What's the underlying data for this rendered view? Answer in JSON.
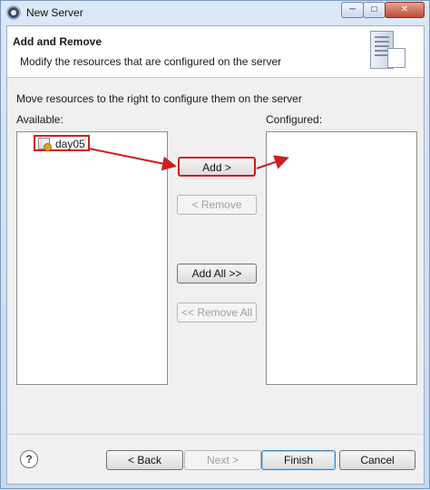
{
  "window": {
    "title": "New Server",
    "min_glyph": "─",
    "max_glyph": "□",
    "close_glyph": "✕"
  },
  "header": {
    "title": "Add and Remove",
    "description": "Modify the resources that are configured on the server"
  },
  "body": {
    "instructions": "Move resources to the right to configure them on the server",
    "available_label": "Available:",
    "configured_label": "Configured:",
    "available_items": [
      {
        "label": "day05"
      }
    ]
  },
  "transfer_buttons": {
    "add": "Add >",
    "remove": "< Remove",
    "add_all": "Add All >>",
    "remove_all": "<< Remove All"
  },
  "footer": {
    "help_glyph": "?",
    "back": "< Back",
    "next": "Next >",
    "finish": "Finish",
    "cancel": "Cancel"
  },
  "annotation_color": "#cc1f1f"
}
